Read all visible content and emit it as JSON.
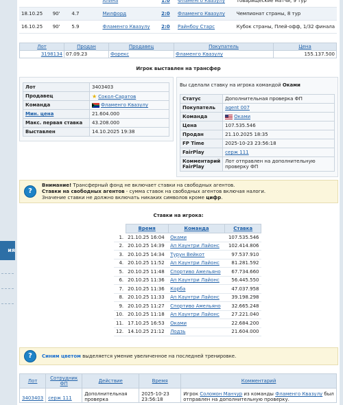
{
  "matches": [
    {
      "date": "",
      "min": "",
      "rate": "",
      "home": "Алина",
      "score": "1:0",
      "away": "Фламенго Квазулу",
      "tournament": "Товарищеские матчи, 9 тур"
    },
    {
      "date": "18.10.25",
      "min": "90'",
      "rate": "4.7",
      "home": "Милфорд",
      "score": "2:0",
      "away": "Фламенго Квазулу",
      "tournament": "Чемпионат страны, 8 тур"
    },
    {
      "date": "16.10.25",
      "min": "90'",
      "rate": "5.9",
      "home": "Фламенго Квазулу",
      "score": "2:0",
      "away": "Райнбоу Старс",
      "tournament": "Кубок страны, Плей-офф, 1/32 финала"
    }
  ],
  "lot_table": {
    "headers": {
      "lot": "Лот",
      "sold": "Продан",
      "seller": "Продавец",
      "buyer": "Покупатель",
      "price": "Цена"
    },
    "row": {
      "lot": "3198134",
      "sold": "07.09.23",
      "seller": "Форекс",
      "buyer": "Фламенго Квазулу",
      "price": "155.137.500"
    }
  },
  "transfer_title": "Игрок выставлен на трансфер",
  "left_info": {
    "lot_label": "Лот",
    "lot": "3403403",
    "seller_label": "Продавец",
    "seller": "Сокол-Саратов",
    "team_label": "Команда",
    "team": "Фламенго Квазулу",
    "min_price_label": "Мин. цена",
    "min_price": "21.604.000",
    "max_first_label": "Макс. первая ставка",
    "max_first": "43.208.000",
    "listed_label": "Выставлен",
    "listed": "14.10.2025 19:38"
  },
  "right_info": {
    "bid_text": "Вы сделали ставку на игрока командой",
    "bid_team": "Оками",
    "status_label": "Статус",
    "status": "Дополнительная проверка ФП",
    "buyer_label": "Покупатель",
    "buyer": "agent 007",
    "team_label": "Команда",
    "team": "Оками",
    "price_label": "Цена",
    "price": "107.535.546",
    "sold_label": "Продан",
    "sold": "21.10.2025 18:35",
    "fptime_label": "FP Time",
    "fptime": "2025-10-23 23:56:18",
    "fairplay_label": "FairPlay",
    "fairplay": "серж 111",
    "comment_label": "Комментарий FairPlay",
    "comment": "Лот отправлен на дополнительную проверку ФП"
  },
  "notice1": {
    "attention_bold": "Внимание!",
    "attention_text": " Трансферный фонд не включает ставки на свободных агентов.",
    "free_bold": "Ставки на свободных агентов",
    "free_text": " - сумма ставок на свободных агентов включая налоги.",
    "value_text": "Значение ставки не должно включать никаких символов кроме ",
    "value_bold": "цифр",
    "value_end": "."
  },
  "bids_title": "Ставки на игрока:",
  "bids_headers": {
    "time": "Время",
    "team": "Команда",
    "bid": "Ставка"
  },
  "bids": [
    {
      "n": "1.",
      "time": "21.10.25 16:04",
      "team": "Оками",
      "bid": "107.535.546"
    },
    {
      "n": "2.",
      "time": "20.10.25 14:39",
      "team": "Ап Каунтри Лайонс",
      "bid": "102.414.806"
    },
    {
      "n": "3.",
      "time": "20.10.25 14:34",
      "team": "Турун Вейкот",
      "bid": "97.537.910"
    },
    {
      "n": "4.",
      "time": "20.10.25 11:52",
      "team": "Ап Каунтри Лайонс",
      "bid": "81.281.592"
    },
    {
      "n": "5.",
      "time": "20.10.25 11:48",
      "team": "Спортиво Амельяно",
      "bid": "67.734.660"
    },
    {
      "n": "6.",
      "time": "20.10.25 11:36",
      "team": "Ап Каунтри Лайонс",
      "bid": "56.445.550"
    },
    {
      "n": "7.",
      "time": "20.10.25 11:36",
      "team": "Корба",
      "bid": "47.037.958"
    },
    {
      "n": "8.",
      "time": "20.10.25 11:33",
      "team": "Ап Каунтри Лайонс",
      "bid": "39.198.298"
    },
    {
      "n": "9.",
      "time": "20.10.25 11:27",
      "team": "Спортиво Амельяно",
      "bid": "32.665.248"
    },
    {
      "n": "10.",
      "time": "20.10.25 11:18",
      "team": "Ап Каунтри Лайонс",
      "bid": "27.221.040"
    },
    {
      "n": "11.",
      "time": "17.10.25 16:53",
      "team": "Оками",
      "bid": "22.684.200"
    },
    {
      "n": "12.",
      "time": "14.10.25 21:12",
      "team": "Лодзь",
      "bid": "21.604.000"
    }
  ],
  "notice2": {
    "blue_text": "Синим цветом",
    "rest": " выделяется умение увеличенное на последней тренировке."
  },
  "history": {
    "headers": {
      "lot": "Лот",
      "emp": "Сотрудник ФП",
      "action": "Действие",
      "time": "Время",
      "comment": "Комментарий"
    },
    "row": {
      "lot": "3403403",
      "emp": "серж 111",
      "action": "Дополнительная проверка",
      "time": "2025-10-23 23:56:18",
      "c1": "Игрок ",
      "c_player": "Соломон Манчур",
      "c2": " из команды ",
      "c_team": "Фламенго Квазулу",
      "c3": " был отправлен на дополнительную проверку."
    }
  },
  "sidebar": {
    "tab_label": "ия"
  },
  "colors": {
    "link": "#1d5fa8",
    "header_bg": "#dde7f1",
    "notice_bg": "#fbf6dc",
    "blue_skill": "#1b6fcf"
  }
}
